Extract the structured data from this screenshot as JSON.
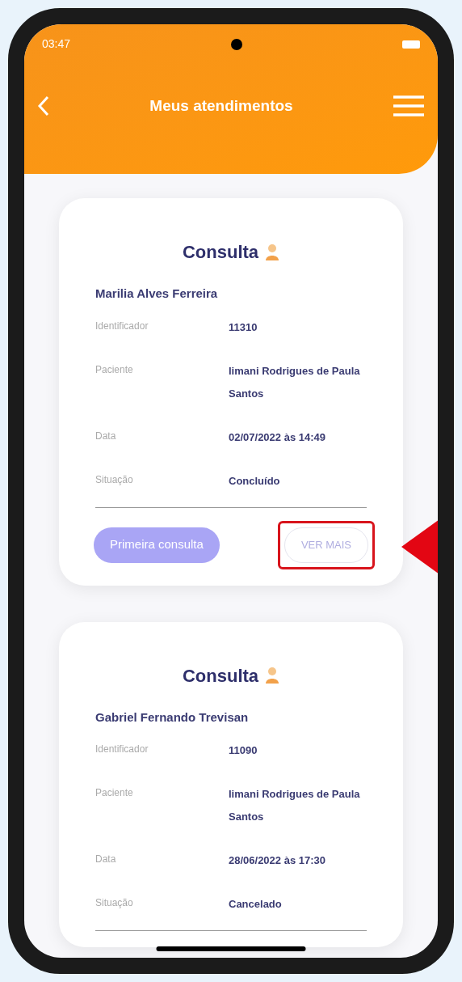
{
  "status_bar": {
    "time": "03:47"
  },
  "header": {
    "title": "Meus atendimentos"
  },
  "cards": [
    {
      "title": "Consulta",
      "name": "Marilia Alves Ferreira",
      "fields": [
        {
          "label": "Identificador",
          "value": "11310"
        },
        {
          "label": "Paciente",
          "value": "Iimani Rodrigues de Paula Santos"
        },
        {
          "label": "Data",
          "value": "02/07/2022 às 14:49"
        },
        {
          "label": "Situação",
          "value": "Concluído"
        }
      ],
      "buttons": [
        {
          "label": "Primeira consulta",
          "kind": "filled",
          "highlighted": false
        },
        {
          "label": "VER MAIS",
          "kind": "outline",
          "highlighted": true
        }
      ]
    },
    {
      "title": "Consulta",
      "name": "Gabriel Fernando Trevisan",
      "fields": [
        {
          "label": "Identificador",
          "value": "11090"
        },
        {
          "label": "Paciente",
          "value": "Iimani Rodrigues de Paula Santos"
        },
        {
          "label": "Data",
          "value": "28/06/2022 às 17:30"
        },
        {
          "label": "Situação",
          "value": "Cancelado"
        }
      ]
    }
  ]
}
